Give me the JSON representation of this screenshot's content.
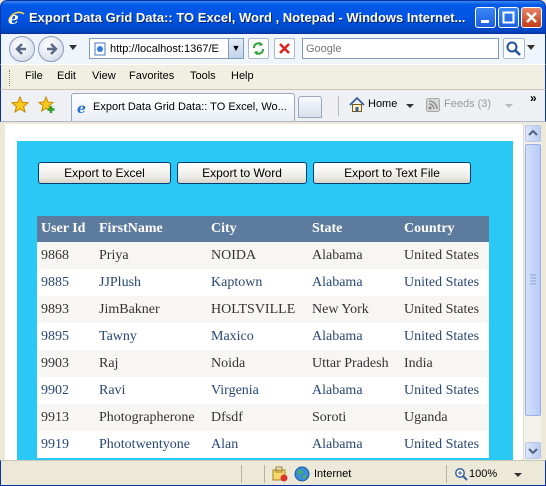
{
  "window": {
    "title": "Export Data Grid Data:: TO Excel, Word , Notepad - Windows Internet..."
  },
  "address": {
    "url": "http://localhost:1367/E"
  },
  "search": {
    "placeholder": "Google"
  },
  "menu": {
    "items": [
      "File",
      "Edit",
      "View",
      "Favorites",
      "Tools",
      "Help"
    ]
  },
  "tabs": {
    "active_label": "Export Data Grid Data:: TO Excel, Wo...",
    "home_label": "Home",
    "feeds_label": "Feeds (3)",
    "more": "»"
  },
  "page": {
    "buttons": {
      "excel": "Export to Excel",
      "word": "Export to Word",
      "text": "Export to Text File"
    },
    "grid": {
      "headers": [
        "User Id",
        "FirstName",
        "City",
        "State",
        "Country"
      ],
      "rows": [
        [
          "9868",
          "Priya",
          "NOIDA",
          "Alabama",
          "United States"
        ],
        [
          "9885",
          "JJPlush",
          "Kaptown",
          "Alabama",
          "United States"
        ],
        [
          "9893",
          "JimBakner",
          "HOLTSVILLE",
          "New York",
          "United States"
        ],
        [
          "9895",
          "Tawny",
          "Maxico",
          "Alabama",
          "United States"
        ],
        [
          "9903",
          "Raj",
          "Noida",
          "Uttar Pradesh",
          "India"
        ],
        [
          "9902",
          "Ravi",
          "Virgenia",
          "Alabama",
          "United States"
        ],
        [
          "9913",
          "Photographerone",
          "Dfsdf",
          "Soroti",
          "Uganda"
        ],
        [
          "9919",
          "Phototwentyone",
          "Alan",
          "Alabama",
          "United States"
        ]
      ]
    }
  },
  "status": {
    "zone": "Internet",
    "zoom": "100%"
  },
  "colors": {
    "panel": "#29c8f5",
    "grid_header": "#5d7b9d",
    "title_bar": "#0055e4"
  }
}
